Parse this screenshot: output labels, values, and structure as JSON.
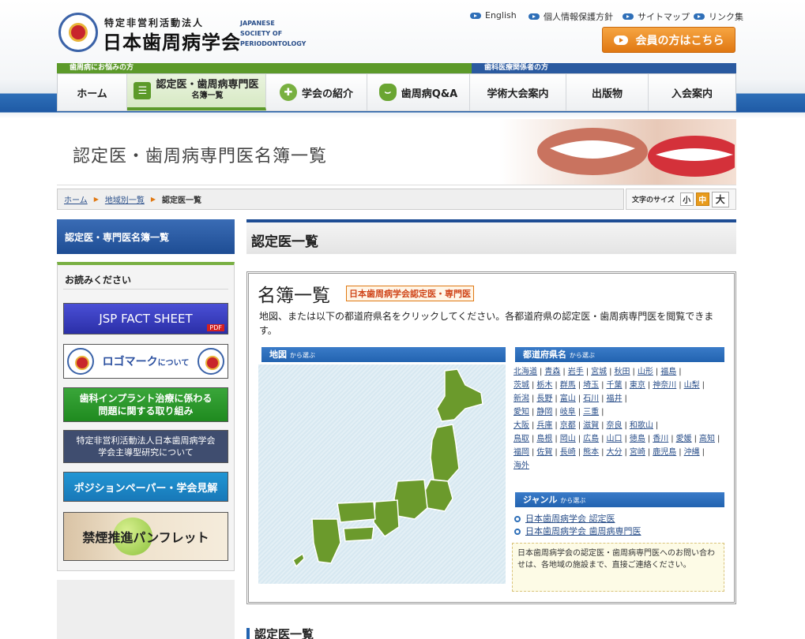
{
  "header": {
    "logo_small": "特定非営利活動法人",
    "logo_main": "日本歯周病学会",
    "logo_en": "JAPANESE SOCIETY OF PERIODONTOLOGY",
    "util_links": [
      "English",
      "個人情報保護方針",
      "サイトマップ",
      "リンク集"
    ],
    "member_button": "会員の方はこちら"
  },
  "audience_bar": {
    "public": "歯周病にお悩みの方",
    "professional": "歯科医療関係者の方"
  },
  "nav": {
    "items": [
      {
        "label": "ホーム"
      },
      {
        "label": "認定医・歯周病専門医",
        "sub": "名簿一覧",
        "active": true,
        "icon": "list-icon"
      },
      {
        "label": "学会の紹介",
        "icon": "plus-icon"
      },
      {
        "label": "歯周病Q&A",
        "icon": "tooth-icon"
      },
      {
        "label": "学術大会案内"
      },
      {
        "label": "出版物"
      },
      {
        "label": "入会案内"
      }
    ]
  },
  "hero": {
    "title": "認定医・歯周病専門医名簿一覧"
  },
  "breadcrumb": [
    "ホーム",
    "地域別一覧",
    "認定医一覧"
  ],
  "font_size": {
    "label": "文字のサイズ",
    "small": "小",
    "medium": "中",
    "large": "大",
    "selected": "中"
  },
  "sidebar": {
    "title": "認定医・専門医名簿一覧",
    "read_heading": "お読みください",
    "banners": {
      "fact_sheet": "JSP FACT SHEET",
      "pdf": "PDF",
      "logo": "ロゴマーク",
      "logo_suffix": "について",
      "implant_1": "歯科インプラント治療に係わる",
      "implant_2": "問題に関する取り組み",
      "research_1": "特定非営利活動法人日本歯周病学会",
      "research_2": "学会主導型研究について",
      "position": "ポジションペーパー・学会見解",
      "smoking": "禁煙推進パンフレット"
    }
  },
  "main": {
    "heading": "認定医一覧",
    "list_title": "名簿一覧",
    "list_badge": "日本歯周病学会認定医・専門医",
    "description": "地図、または以下の都道府県名をクリックしてください。各都道府県の認定医・歯周病専門医を閲覧できます。",
    "map_section": {
      "title": "地図",
      "suffix": "から選ぶ"
    },
    "pref_section": {
      "title": "都道府県名",
      "suffix": "から選ぶ"
    },
    "prefecture_rows": [
      [
        "北海道",
        "青森",
        "岩手",
        "宮城",
        "秋田",
        "山形",
        "福島"
      ],
      [
        "茨城",
        "栃木",
        "群馬",
        "埼玉",
        "千葉",
        "東京",
        "神奈川",
        "山梨"
      ],
      [
        "新潟",
        "長野",
        "富山",
        "石川",
        "福井"
      ],
      [
        "愛知",
        "静岡",
        "岐阜",
        "三重"
      ],
      [
        "大阪",
        "兵庫",
        "京都",
        "滋賀",
        "奈良",
        "和歌山"
      ],
      [
        "鳥取",
        "島根",
        "岡山",
        "広島",
        "山口",
        "徳島",
        "香川",
        "愛媛",
        "高知"
      ],
      [
        "福岡",
        "佐賀",
        "長崎",
        "熊本",
        "大分",
        "宮崎",
        "鹿児島",
        "沖縄"
      ],
      [
        "海外"
      ]
    ],
    "genre_section": {
      "title": "ジャンル",
      "suffix": "から選ぶ"
    },
    "genres": [
      "日本歯周病学会 認定医",
      "日本歯周病学会 歯周病専門医"
    ],
    "note": "日本歯周病学会の認定医・歯周病専門医へのお問い合わせは、各地域の施設まで、直接ご連絡ください。",
    "bottom_heading": "認定医一覧"
  },
  "colors": {
    "brand_blue": "#1e4d94",
    "brand_green": "#5c9a2a",
    "accent_orange": "#e07812",
    "link": "#2a4f8a"
  }
}
